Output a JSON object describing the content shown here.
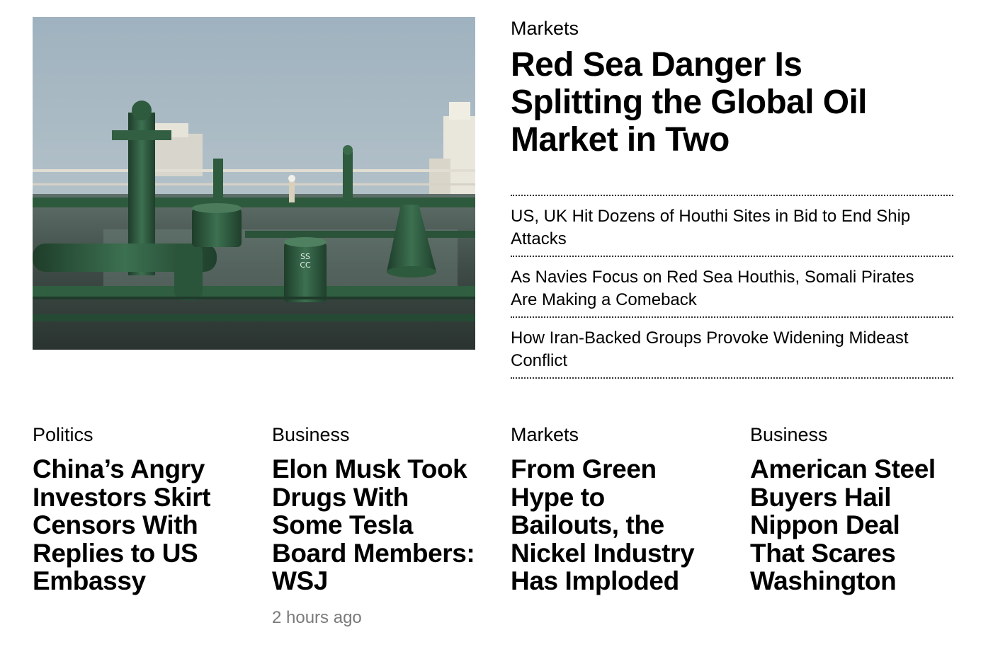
{
  "lead": {
    "image_icon": "oil-tanker-deck-photo",
    "section": "Markets",
    "headline": "Red Sea Danger Is Splitting the Global Oil Market in Two",
    "related": [
      "US, UK Hit Dozens of Houthi Sites in Bid to End Ship Attacks",
      "As Navies Focus on Red Sea Houthis, Somali Pirates Are Making a Comeback",
      "How Iran-Backed Groups Provoke Widening Mideast Conflict"
    ]
  },
  "stories": [
    {
      "section": "Politics",
      "headline": "China’s Angry Investors Skirt Censors With Replies to US Embassy",
      "timestamp": ""
    },
    {
      "section": "Business",
      "headline": "Elon Musk Took Drugs With Some Tesla Board Members: WSJ",
      "timestamp": "2 hours ago"
    },
    {
      "section": "Markets",
      "headline": "From Green Hype to Bailouts, the Nickel Industry Has Imploded",
      "timestamp": ""
    },
    {
      "section": "Business",
      "headline": "American Steel Buyers Hail Nippon Deal That Scares Washington",
      "timestamp": ""
    }
  ],
  "colors": {
    "sky": "#a9bac4",
    "hull_green": "#2f5a3c",
    "deck": "#3f4a44",
    "timestamp_gray": "#7a7a7a"
  }
}
